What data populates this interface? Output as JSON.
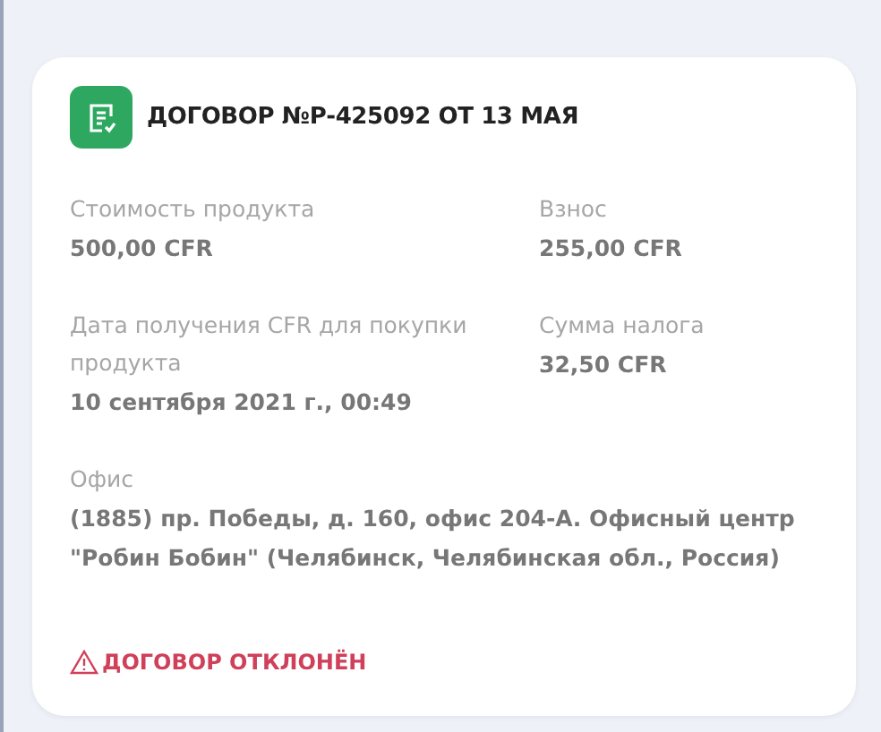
{
  "contract": {
    "title": "ДОГОВОР №Р-425092 ОТ 13 МАЯ",
    "fields": [
      {
        "label": "Стоимость продукта",
        "value": "500,00 CFR"
      },
      {
        "label": "Взнос",
        "value": "255,00 CFR"
      },
      {
        "label": "Дата получения CFR для покупки продукта",
        "value": "10 сентября 2021 г., 00:49"
      },
      {
        "label": "Сумма налога",
        "value": "32,50 CFR"
      }
    ],
    "office": {
      "label": "Офис",
      "value": "(1885) пр. Победы, д. 160, офис 204-А. Офисный центр \"Робин Бобин\" (Челябинск, Челябинская обл., Россия)"
    },
    "status": {
      "kind": "rejected",
      "text": "ДОГОВОР ОТКЛОНЁН"
    }
  }
}
